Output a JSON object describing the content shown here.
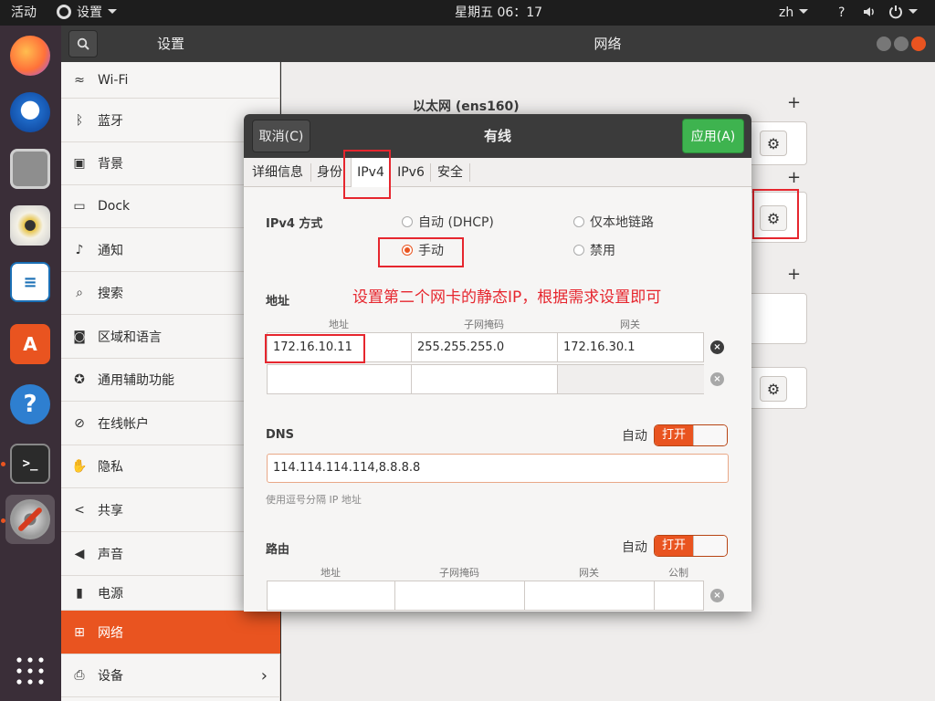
{
  "topbar": {
    "activities": "活动",
    "app_menu": "设置",
    "clock": "星期五 06：17",
    "lang": "zh",
    "accessibility": "?",
    "volume_icon": "speaker-icon",
    "power_icon": "power-icon"
  },
  "dock": {
    "apps": [
      "Firefox",
      "Thunderbird",
      "Files",
      "Rhythmbox",
      "LibreOffice Writer",
      "Ubuntu Software",
      "Help",
      "Terminal",
      "Settings"
    ],
    "show_apps_icon": "grid-icon"
  },
  "settings": {
    "sidebar_title": "设置",
    "main_title": "网络",
    "sidebar_items": [
      {
        "label": "Wi-Fi",
        "icon": "wifi-icon"
      },
      {
        "label": "蓝牙",
        "icon": "bluetooth-icon"
      },
      {
        "label": "背景",
        "icon": "background-icon"
      },
      {
        "label": "Dock",
        "icon": "dock-icon"
      },
      {
        "label": "通知",
        "icon": "bell-icon"
      },
      {
        "label": "搜索",
        "icon": "search-icon"
      },
      {
        "label": "区域和语言",
        "icon": "camera-icon"
      },
      {
        "label": "通用辅助功能",
        "icon": "accessibility-icon"
      },
      {
        "label": "在线帐户",
        "icon": "online-accounts-icon"
      },
      {
        "label": "隐私",
        "icon": "hand-icon"
      },
      {
        "label": "共享",
        "icon": "share-icon"
      },
      {
        "label": "声音",
        "icon": "speaker-icon"
      },
      {
        "label": "电源",
        "icon": "power-plug-icon"
      },
      {
        "label": "网络",
        "icon": "network-icon"
      },
      {
        "label": "设备",
        "icon": "devices-icon"
      }
    ],
    "ethernet_title": "以太网 (ens160)",
    "plus": "+"
  },
  "dialog": {
    "cancel": "取消(C)",
    "title": "有线",
    "apply": "应用(A)",
    "tabs": [
      "详细信息",
      "身份",
      "IPv4",
      "IPv6",
      "安全"
    ],
    "ipv4_method_label": "IPv4 方式",
    "methods": {
      "auto": "自动 (DHCP)",
      "link_local": "仅本地链路",
      "manual": "手动",
      "disabled": "禁用"
    },
    "address_section": "地址",
    "col_address": "地址",
    "col_netmask": "子网掩码",
    "col_gateway": "网关",
    "addresses": [
      {
        "address": "172.16.10.11",
        "netmask": "255.255.255.0",
        "gateway": "172.16.30.1"
      },
      {
        "address": "",
        "netmask": "",
        "gateway": ""
      }
    ],
    "dns_label": "DNS",
    "auto_label": "自动",
    "switch_on": "打开",
    "dns_value": "114.114.114.114,8.8.8.8",
    "dns_hint": "使用逗号分隔 IP 地址",
    "routes_label": "路由",
    "col_metric": "公制"
  },
  "annotation": {
    "text": "设置第二个网卡的静态IP，根据需求设置即可",
    "color": "#e6262e"
  }
}
